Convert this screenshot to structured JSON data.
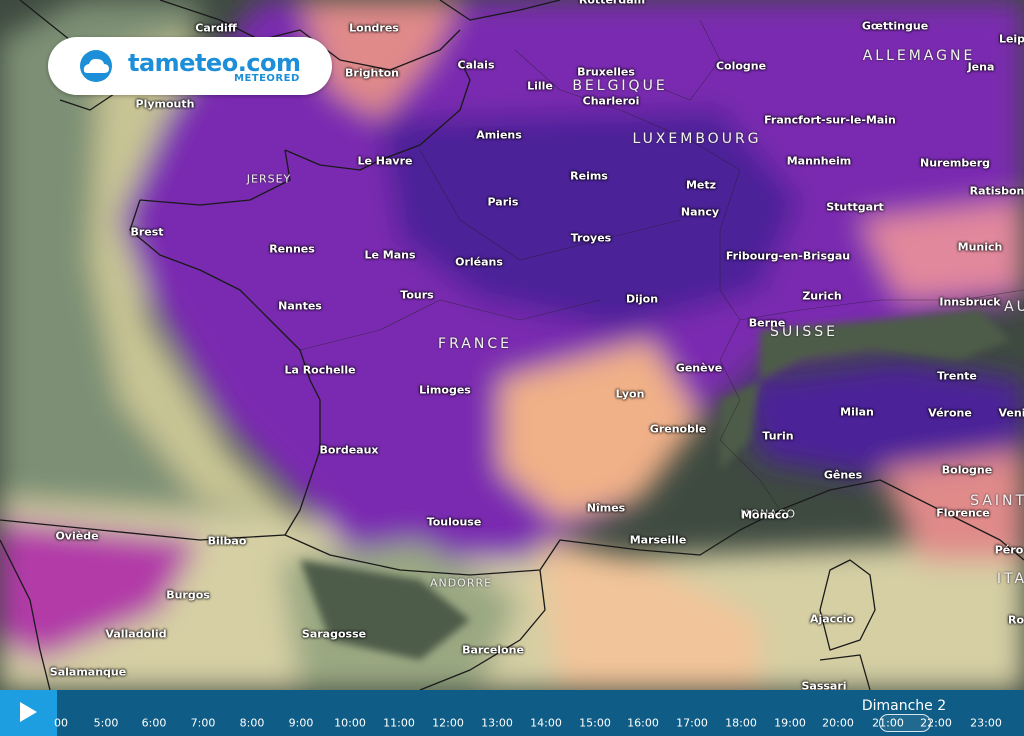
{
  "logo": {
    "brand": "tameteo.com",
    "sub": "METEORED",
    "icon": "cloud-icon"
  },
  "countries": [
    {
      "id": "allemagne",
      "label": "ALLEMAGNE"
    },
    {
      "id": "belgique",
      "label": "BELGIQUE"
    },
    {
      "id": "luxembourg",
      "label": "LUXEMBOURG"
    },
    {
      "id": "france",
      "label": "FRANCE"
    },
    {
      "id": "suisse",
      "label": "SUISSE"
    },
    {
      "id": "andorre",
      "label": "ANDORRE"
    },
    {
      "id": "jersey",
      "label": "JERSEY"
    },
    {
      "id": "monaco",
      "label": "MONACO"
    },
    {
      "id": "saint",
      "label": "SAINT-"
    },
    {
      "id": "ita",
      "label": "ITA"
    },
    {
      "id": "au",
      "label": "AU"
    }
  ],
  "cities": [
    "Rotterdam",
    "Cardiff",
    "Londres",
    "Gœttingue",
    "Leip",
    "Brighton",
    "Calais",
    "Bruxelles",
    "Cologne",
    "Jena",
    "Plymouth",
    "Lille",
    "Charleroi",
    "Amiens",
    "Francfort-sur-le-Main",
    "Le Havre",
    "Mannheim",
    "Nuremberg",
    "Reims",
    "Metz",
    "Ratisbon",
    "Paris",
    "Stuttgart",
    "Brest",
    "Nancy",
    "Troyes",
    "Munich",
    "Rennes",
    "Le Mans",
    "Orléans",
    "Fribourg-en-Brisgau",
    "Tours",
    "Zurich",
    "Innsbruck",
    "Nantes",
    "Dijon",
    "Berne",
    "Genève",
    "La Rochelle",
    "Trente",
    "Limoges",
    "Lyon",
    "Milan",
    "Vérone",
    "Veni",
    "Grenoble",
    "Turin",
    "Bordeaux",
    "Gênes",
    "Bologne",
    "Nîmes",
    "Monaco",
    "Florence",
    "Toulouse",
    "Oviède",
    "Bilbao",
    "Marseille",
    "Péro",
    "Burgos",
    "Ajaccio",
    "Valladolid",
    "Saragosse",
    "Ro",
    "Barcelone",
    "Salamanque",
    "Sassari"
  ],
  "timeline": {
    "play_icon": "play-icon",
    "day_label": "Dimanche 2",
    "selected_hour": "20:00",
    "hours": [
      "00",
      "5:00",
      "6:00",
      "7:00",
      "8:00",
      "9:00",
      "10:00",
      "11:00",
      "12:00",
      "13:00",
      "14:00",
      "15:00",
      "16:00",
      "17:00",
      "18:00",
      "19:00",
      "20:00",
      "21:00",
      "22:00",
      "23:00"
    ]
  },
  "colors": {
    "sea": "#3e4a40",
    "precip_low": "#d9d3a8",
    "precip_mid": "#f2b48c",
    "precip_high": "#8a1fb0",
    "precip_max": "#3f1f9a",
    "timeline_bg": "#0f5d86",
    "play_bg": "#1c9ee0",
    "brand": "#1c8fd8"
  }
}
